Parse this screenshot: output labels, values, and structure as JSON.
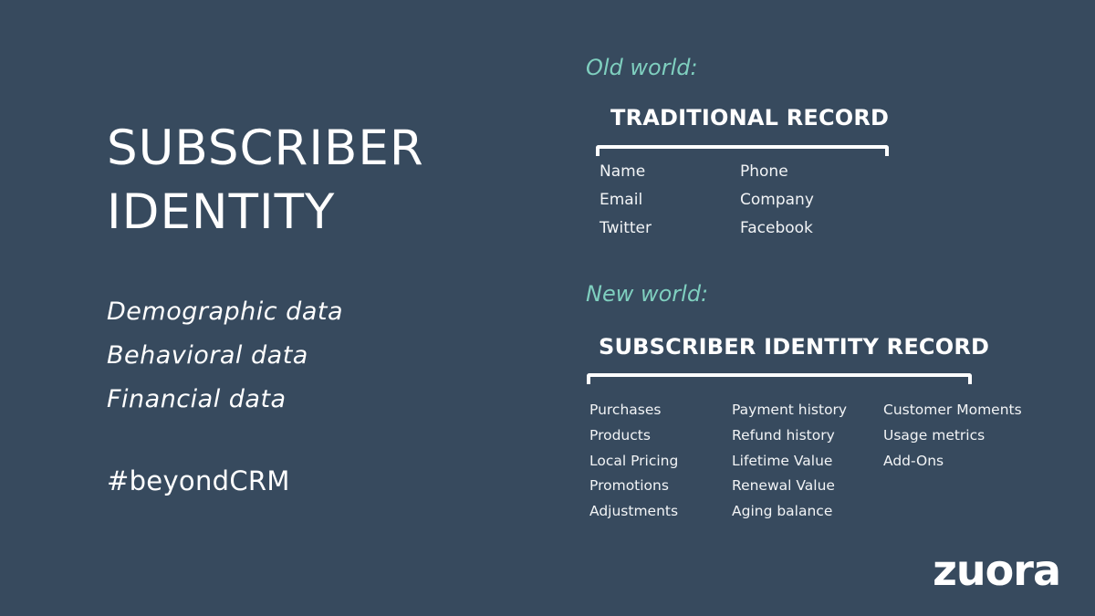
{
  "slide": {
    "title_lines": [
      "SUBSCRIBER",
      "IDENTITY"
    ],
    "data_types": [
      "Demographic data",
      "Behavioral data",
      "Financial data"
    ],
    "hashtag": "#beyondCRM",
    "logo_text": "zuora",
    "colors": {
      "background": "#374a5e",
      "accent": "#7fcfbf",
      "text": "#ffffff"
    }
  },
  "old_world": {
    "label": "Old world:",
    "record_title": "TRADITIONAL RECORD",
    "columns": [
      [
        "Name",
        "Email",
        "Twitter"
      ],
      [
        "Phone",
        "Company",
        "Facebook"
      ]
    ]
  },
  "new_world": {
    "label": "New world:",
    "record_title": "SUBSCRIBER IDENTITY RECORD",
    "columns": [
      [
        "Purchases",
        "Products",
        "Local Pricing",
        "Promotions",
        "Adjustments"
      ],
      [
        "Payment history",
        "Refund history",
        "Lifetime Value",
        "Renewal Value",
        "Aging balance"
      ],
      [
        "Customer Moments",
        "Usage metrics",
        "Add-Ons"
      ]
    ]
  }
}
